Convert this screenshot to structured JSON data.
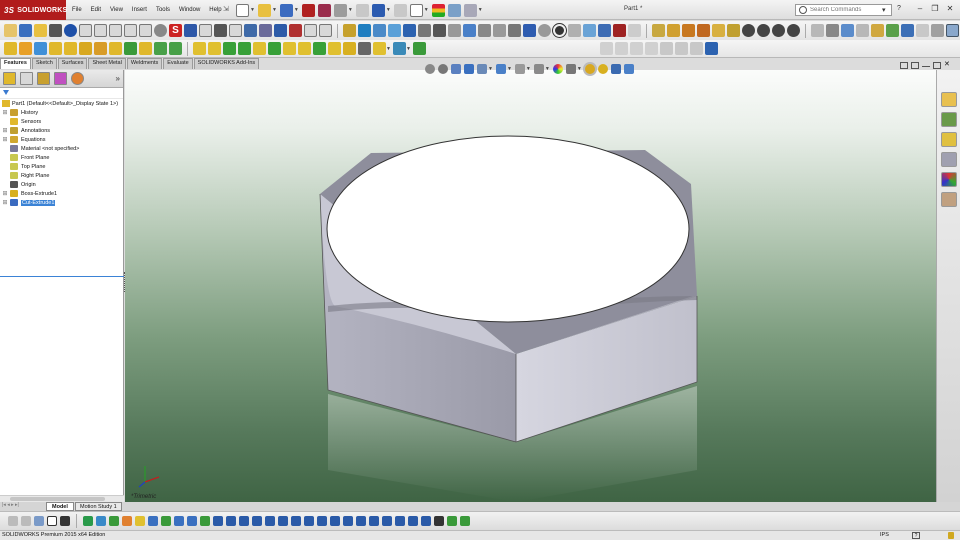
{
  "app": {
    "logo_text": "SOLIDWORKS",
    "logo_glyph": "3S",
    "document_title": "Part1 *",
    "title_pin": "⇲"
  },
  "menu": [
    "File",
    "Edit",
    "View",
    "Insert",
    "Tools",
    "Window",
    "Help"
  ],
  "search": {
    "placeholder": "Search Commands"
  },
  "command_tabs": [
    "Features",
    "Sketch",
    "Surfaces",
    "Sheet Metal",
    "Weldments",
    "Evaluate",
    "SOLIDWORKS Add-Ins"
  ],
  "feature_tree": {
    "root": "Part1  (Default<<Default>_Display State 1>)",
    "items": [
      {
        "label": "History",
        "expandable": true,
        "icon": "history-icon"
      },
      {
        "label": "Sensors",
        "expandable": false,
        "icon": "sensor-icon"
      },
      {
        "label": "Annotations",
        "expandable": true,
        "icon": "annotation-icon"
      },
      {
        "label": "Equations",
        "expandable": true,
        "icon": "equation-icon"
      },
      {
        "label": "Material <not specified>",
        "expandable": false,
        "icon": "material-icon"
      },
      {
        "label": "Front Plane",
        "expandable": false,
        "icon": "plane-icon"
      },
      {
        "label": "Top Plane",
        "expandable": false,
        "icon": "plane-icon"
      },
      {
        "label": "Right Plane",
        "expandable": false,
        "icon": "plane-icon"
      },
      {
        "label": "Origin",
        "expandable": false,
        "icon": "origin-icon"
      },
      {
        "label": "Boss-Extrude1",
        "expandable": true,
        "icon": "boss-extrude-icon"
      },
      {
        "label": "Cut-Extrude1",
        "expandable": true,
        "icon": "cut-extrude-icon",
        "selected": true
      }
    ]
  },
  "viewport": {
    "view_name": "*Trimetric"
  },
  "bottom_tabs": {
    "model": "Model",
    "motion": "Motion Study 1"
  },
  "status": {
    "text": "SOLIDWORKS Premium 2015 x64 Edition",
    "units": "IPS",
    "help": "?"
  },
  "colors": {
    "logo_bg": "#b11c1c",
    "selection": "#3b83d6",
    "viewport_top": "#fbfcfb",
    "viewport_bottom": "#3f6444",
    "model_face": "#9e9eac",
    "model_top": "#ffffff"
  }
}
